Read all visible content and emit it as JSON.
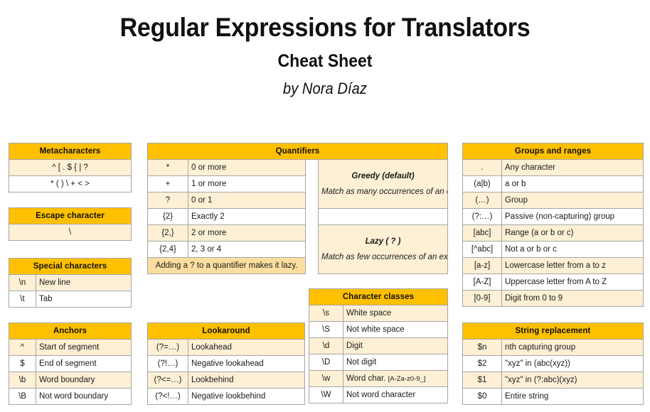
{
  "title": {
    "main": "Regular Expressions for Translators",
    "subtitle": "Cheat Sheet",
    "author": "by Nora Díaz"
  },
  "colors": {
    "header_bg": "#FFC000",
    "row_alt_bg": "#FDF0D5",
    "row_plain_bg": "#FFFFFF",
    "note_bg": "#FCDFA0",
    "border": "#A6A6A6",
    "text": "#111111"
  },
  "tables": {
    "metacharacters": {
      "header": "Metacharacters",
      "rows": [
        "^  [  .  $  {  |  ?",
        "*  (  )  \\  +  <  >"
      ]
    },
    "escape": {
      "header": "Escape character",
      "rows": [
        "\\"
      ]
    },
    "special": {
      "header": "Special characters",
      "rows": [
        {
          "key": "\\n",
          "value": "New line"
        },
        {
          "key": "\\t",
          "value": "Tab"
        }
      ]
    },
    "anchors": {
      "header": "Anchors",
      "rows": [
        {
          "key": "^",
          "value": "Start of segment"
        },
        {
          "key": "$",
          "value": "End of segment"
        },
        {
          "key": "\\b",
          "value": "Word boundary"
        },
        {
          "key": "\\B",
          "value": "Not word boundary"
        }
      ]
    },
    "quantifiers": {
      "header": "Quantifiers",
      "rows": [
        {
          "key": "*",
          "value": "0 or more"
        },
        {
          "key": "+",
          "value": "1 or more"
        },
        {
          "key": "?",
          "value": "0 or 1"
        },
        {
          "key": "{2}",
          "value": "Exactly 2"
        },
        {
          "key": "{2,}",
          "value": "2 or more"
        },
        {
          "key": "{2,4}",
          "value": "2, 3 or 4"
        }
      ],
      "note": "Adding a ? to a quantifier makes it lazy.",
      "greedy": {
        "title": "Greedy  (default)",
        "body": "Match as many occurrences of an expression as possible."
      },
      "lazy": {
        "title": "Lazy  ( ? )",
        "body": "Match as few occurrences of an expression as possible."
      }
    },
    "lookaround": {
      "header": "Lookaround",
      "rows": [
        {
          "key": "(?=…)",
          "value": "Lookahead"
        },
        {
          "key": "(?!…)",
          "value": "Negative lookahead"
        },
        {
          "key": "(?<=…)",
          "value": "Lookbehind"
        },
        {
          "key": "(?<!…)",
          "value": "Negative lookbehind"
        }
      ]
    },
    "charclasses": {
      "header": "Character classes",
      "rows": [
        {
          "key": "\\s",
          "value": "White space"
        },
        {
          "key": "\\S",
          "value": "Not white space"
        },
        {
          "key": "\\d",
          "value": "Digit"
        },
        {
          "key": "\\D",
          "value": "Not digit"
        },
        {
          "key": "\\w",
          "value": "Word char.",
          "extra": "[A-Za-z0-9_]"
        },
        {
          "key": "\\W",
          "value": "Not word character"
        }
      ]
    },
    "groups": {
      "header": "Groups and ranges",
      "rows": [
        {
          "key": ".",
          "value": "Any character"
        },
        {
          "key": "(a|b)",
          "value": "a or b"
        },
        {
          "key": "(…)",
          "value": "Group"
        },
        {
          "key": "(?:…)",
          "value": "Passive (non-capturing) group"
        },
        {
          "key": "[abc]",
          "value": "Range (a or b or c)"
        },
        {
          "key": "[^abc]",
          "value": "Not a or b or c"
        },
        {
          "key": "[a-z]",
          "value": "Lowercase letter from a to z"
        },
        {
          "key": "[A-Z]",
          "value": "Uppercase letter from A to Z"
        },
        {
          "key": "[0-9]",
          "value": "Digit from 0 to 9"
        }
      ]
    },
    "stringreplacement": {
      "header": "String replacement",
      "rows": [
        {
          "key": "$n",
          "value": "nth capturing group"
        },
        {
          "key": "$2",
          "value": "\"xyz\" in (abc(xyz))"
        },
        {
          "key": "$1",
          "value": "\"xyz\" in (?:abc)(xyz)"
        },
        {
          "key": "$0",
          "value": "Entire string"
        }
      ]
    }
  }
}
